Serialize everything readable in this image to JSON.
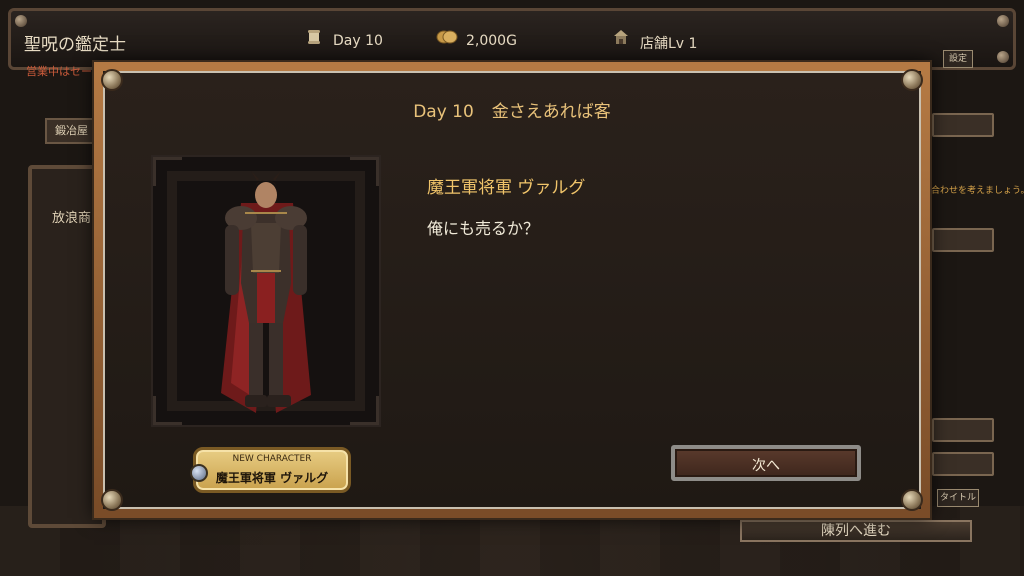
{
  "hud": {
    "game_title": "聖呪の鑑定士",
    "day": "Day 10",
    "gold": "2,000G",
    "shop_level": "店舗Lv 1",
    "notice": "営業中はセーブ",
    "settings_label": "設定"
  },
  "background": {
    "smithy_tab": "鍛冶屋",
    "wanderer_label": "放浪商",
    "right_hint": "合わせを考えましょう。",
    "title_label": "タイトル",
    "proceed_label": "陳列へ進む"
  },
  "dialog": {
    "day": "Day 10",
    "event_title": "金さえあれば客",
    "speaker": "魔王軍将軍 ヴァルグ",
    "line": "俺にも売るか？",
    "badge_caption": "NEW CHARACTER",
    "badge_name": "魔王軍将軍 ヴァルグ",
    "next_button": "次へ"
  },
  "colors": {
    "frame": "#b57a44",
    "heading": "#e9c27a",
    "speaker": "#f0c46a",
    "badge": "#d9b96a",
    "armor_red": "#7a1e1e"
  },
  "icons": [
    "scroll-icon",
    "coin-icon",
    "shop-icon"
  ]
}
